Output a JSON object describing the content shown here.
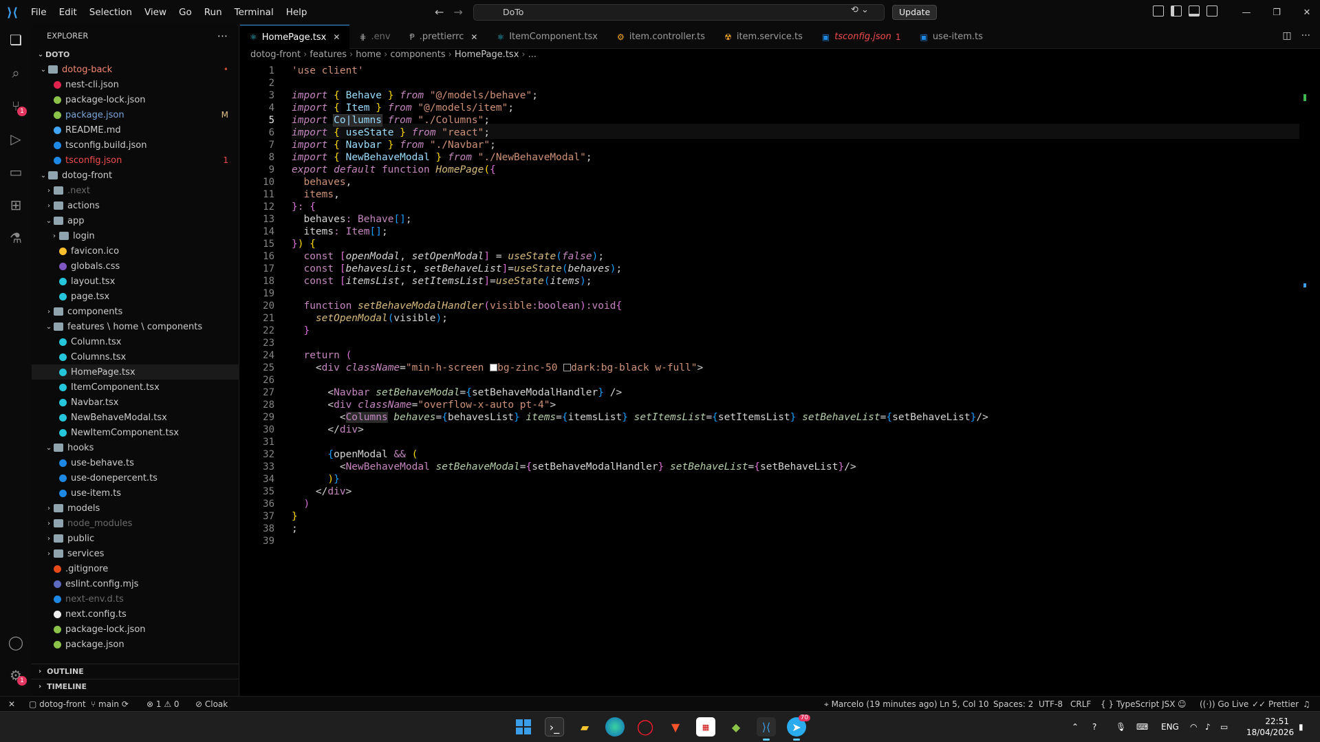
{
  "titlebar": {
    "menus": [
      "File",
      "Edit",
      "Selection",
      "View",
      "Go",
      "Run",
      "Terminal",
      "Help"
    ],
    "search_text": "DoTo",
    "update_label": "Update"
  },
  "explorer": {
    "title": "EXPLORER",
    "workspace": "DOTO",
    "rows": [
      {
        "label": "dotog-back",
        "depth": 0,
        "type": "folder-open",
        "color": "#f48771",
        "badge": "•",
        "badge_color": "#c74e39"
      },
      {
        "label": "nest-cli.json",
        "depth": 1,
        "type": "file",
        "icon_color": "#e0234e",
        "color": "#cccccc"
      },
      {
        "label": "package-lock.json",
        "depth": 1,
        "type": "file",
        "icon_color": "#8bc34a",
        "color": "#cccccc"
      },
      {
        "label": "package.json",
        "depth": 1,
        "type": "file",
        "icon_color": "#8bc34a",
        "color": "#7aa6d9",
        "badge": "M",
        "badge_color": "#e2c08d"
      },
      {
        "label": "README.md",
        "depth": 1,
        "type": "file",
        "icon_color": "#42a5f5",
        "color": "#cccccc"
      },
      {
        "label": "tsconfig.build.json",
        "depth": 1,
        "type": "file",
        "icon_color": "#1e88e5",
        "color": "#cccccc"
      },
      {
        "label": "tsconfig.json",
        "depth": 1,
        "type": "file",
        "icon_color": "#1e88e5",
        "color": "#f14c4c",
        "badge": "1",
        "badge_color": "#f14c4c"
      },
      {
        "label": "dotog-front",
        "depth": 0,
        "type": "folder-open",
        "color": "#cccccc"
      },
      {
        "label": ".next",
        "depth": 1,
        "type": "folder",
        "color": "#6b6b6b"
      },
      {
        "label": "actions",
        "depth": 1,
        "type": "folder",
        "color": "#cccccc"
      },
      {
        "label": "app",
        "depth": 1,
        "type": "folder-open",
        "color": "#cccccc"
      },
      {
        "label": "login",
        "depth": 2,
        "type": "folder",
        "color": "#cccccc"
      },
      {
        "label": "favicon.ico",
        "depth": 2,
        "type": "file",
        "icon_color": "#fbc02d",
        "color": "#cccccc"
      },
      {
        "label": "globals.css",
        "depth": 2,
        "type": "file",
        "icon_color": "#7e57c2",
        "color": "#cccccc"
      },
      {
        "label": "layout.tsx",
        "depth": 2,
        "type": "file",
        "icon_color": "#26c6da",
        "color": "#cccccc"
      },
      {
        "label": "page.tsx",
        "depth": 2,
        "type": "file",
        "icon_color": "#26c6da",
        "color": "#cccccc"
      },
      {
        "label": "components",
        "depth": 1,
        "type": "folder",
        "color": "#cccccc"
      },
      {
        "label": "features \\ home \\ components",
        "depth": 1,
        "type": "folder-open",
        "color": "#cccccc"
      },
      {
        "label": "Column.tsx",
        "depth": 2,
        "type": "file",
        "icon_color": "#26c6da",
        "color": "#cccccc"
      },
      {
        "label": "Columns.tsx",
        "depth": 2,
        "type": "file",
        "icon_color": "#26c6da",
        "color": "#cccccc"
      },
      {
        "label": "HomePage.tsx",
        "depth": 2,
        "type": "file",
        "icon_color": "#26c6da",
        "color": "#cccccc",
        "selected": true
      },
      {
        "label": "ItemComponent.tsx",
        "depth": 2,
        "type": "file",
        "icon_color": "#26c6da",
        "color": "#cccccc"
      },
      {
        "label": "Navbar.tsx",
        "depth": 2,
        "type": "file",
        "icon_color": "#26c6da",
        "color": "#cccccc"
      },
      {
        "label": "NewBehaveModal.tsx",
        "depth": 2,
        "type": "file",
        "icon_color": "#26c6da",
        "color": "#cccccc"
      },
      {
        "label": "NewItemComponent.tsx",
        "depth": 2,
        "type": "file",
        "icon_color": "#26c6da",
        "color": "#cccccc"
      },
      {
        "label": "hooks",
        "depth": 1,
        "type": "folder-open",
        "color": "#cccccc"
      },
      {
        "label": "use-behave.ts",
        "depth": 2,
        "type": "file",
        "icon_color": "#1e88e5",
        "color": "#cccccc"
      },
      {
        "label": "use-donepercent.ts",
        "depth": 2,
        "type": "file",
        "icon_color": "#1e88e5",
        "color": "#cccccc"
      },
      {
        "label": "use-item.ts",
        "depth": 2,
        "type": "file",
        "icon_color": "#1e88e5",
        "color": "#cccccc"
      },
      {
        "label": "models",
        "depth": 1,
        "type": "folder",
        "color": "#cccccc"
      },
      {
        "label": "node_modules",
        "depth": 1,
        "type": "folder",
        "color": "#6b6b6b"
      },
      {
        "label": "public",
        "depth": 1,
        "type": "folder",
        "color": "#cccccc"
      },
      {
        "label": "services",
        "depth": 1,
        "type": "folder",
        "color": "#cccccc"
      },
      {
        "label": ".gitignore",
        "depth": 1,
        "type": "file",
        "icon_color": "#e64a19",
        "color": "#cccccc"
      },
      {
        "label": "eslint.config.mjs",
        "depth": 1,
        "type": "file",
        "icon_color": "#5c6bc0",
        "color": "#cccccc"
      },
      {
        "label": "next-env.d.ts",
        "depth": 1,
        "type": "file",
        "icon_color": "#1e88e5",
        "color": "#6b6b6b"
      },
      {
        "label": "next.config.ts",
        "depth": 1,
        "type": "file",
        "icon_color": "#eeeeee",
        "color": "#cccccc"
      },
      {
        "label": "package-lock.json",
        "depth": 1,
        "type": "file",
        "icon_color": "#8bc34a",
        "color": "#cccccc"
      },
      {
        "label": "package.json",
        "depth": 1,
        "type": "file",
        "icon_color": "#8bc34a",
        "color": "#cccccc"
      }
    ],
    "outline_label": "OUTLINE",
    "timeline_label": "TIMELINE"
  },
  "tabs": [
    {
      "label": "HomePage.tsx",
      "icon": "⚛",
      "icon_color": "#26c6da",
      "active": true,
      "close": "✕"
    },
    {
      "label": ".env",
      "icon": "⋕",
      "icon_color": "#9d9d9d",
      "color": "#6b6b6b"
    },
    {
      "label": ".prettierrc",
      "icon": "Ᵽ",
      "icon_color": "#a0a0a0",
      "close": "✕"
    },
    {
      "label": "ItemComponent.tsx",
      "icon": "⚛",
      "icon_color": "#26c6da"
    },
    {
      "label": "item.controller.ts",
      "icon": "⚙",
      "icon_color": "#f9a825"
    },
    {
      "label": "item.service.ts",
      "icon": "☢",
      "icon_color": "#f9a825"
    },
    {
      "label": "tsconfig.json",
      "icon": "▣",
      "icon_color": "#1e88e5",
      "color": "#f14c4c",
      "italic": true,
      "badge": "1"
    },
    {
      "label": "use-item.ts",
      "icon": "▣",
      "icon_color": "#1e88e5"
    }
  ],
  "breadcrumb": [
    "dotog-front",
    "features",
    "home",
    "components",
    "HomePage.tsx",
    "..."
  ],
  "editor": {
    "current_line": 5,
    "line_count": 39
  },
  "statusbar": {
    "branch_folder": "dotog-front",
    "branch": "main",
    "problems_errors": "1",
    "problems_warnings": "0",
    "cloak": "Cloak",
    "blame": "Marcelo (19 minutes ago)",
    "position": "Ln 5, Col 10",
    "spaces": "Spaces: 2",
    "encoding": "UTF-8",
    "eol": "CRLF",
    "language": "TypeScript JSX",
    "golive": "Go Live",
    "prettier": "Prettier"
  },
  "taskbar": {
    "lang": "ENG",
    "time": "22:51",
    "date": "18/04/2026",
    "telegram_badge": "70"
  }
}
